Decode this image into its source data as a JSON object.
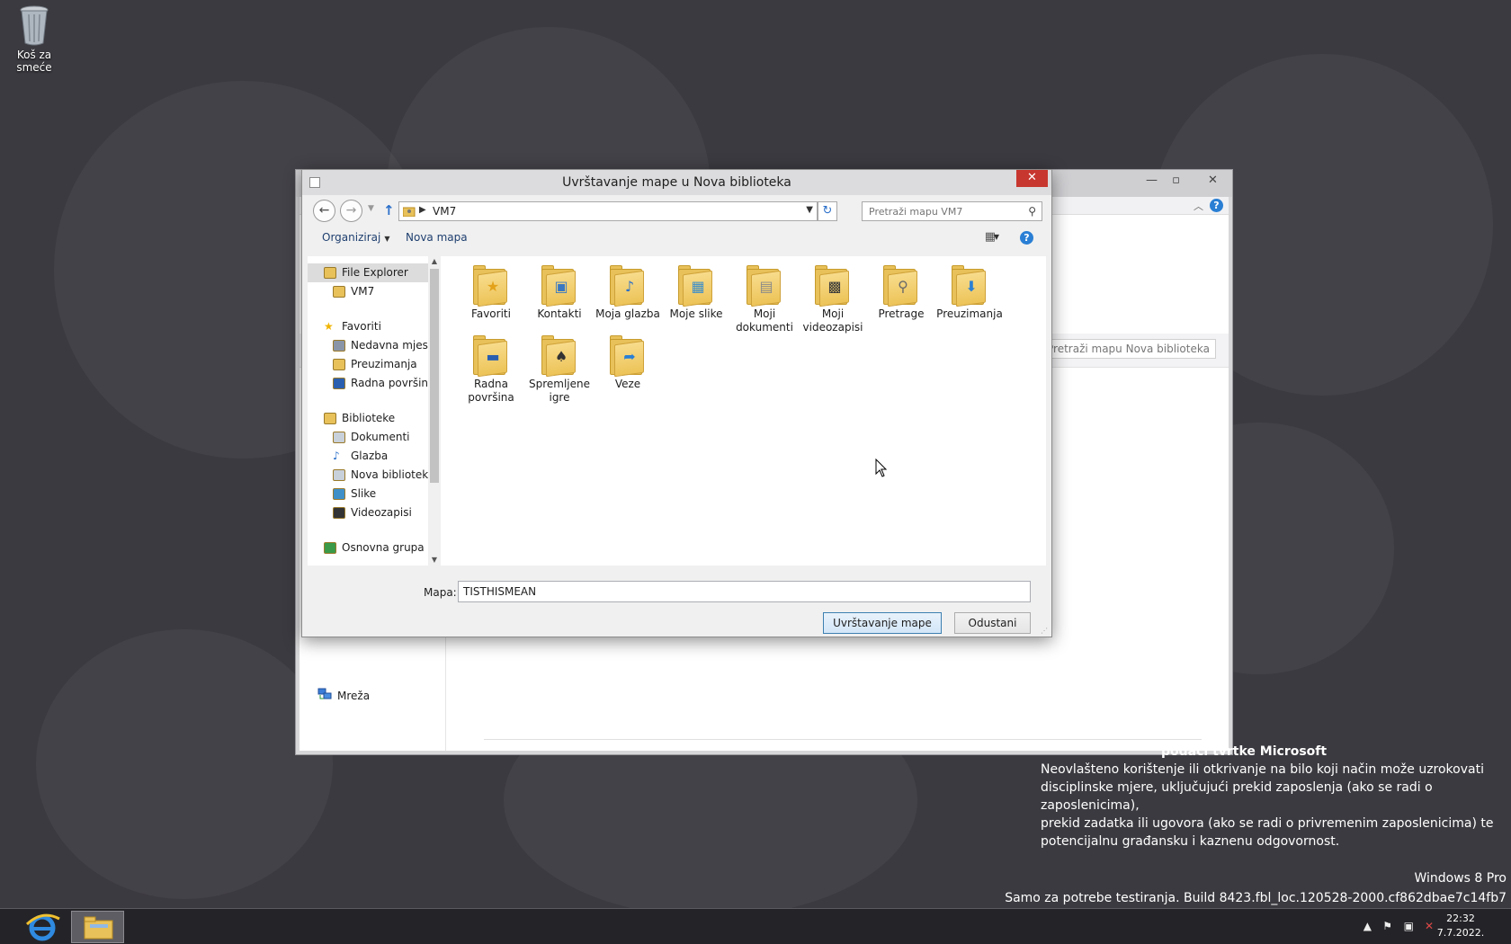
{
  "desktop": {
    "recycle_bin_label": "Koš za smeće"
  },
  "background_window": {
    "search_placeholder": "Pretraži mapu Nova biblioteka",
    "network_label": "Mreža"
  },
  "dialog": {
    "title": "Uvrštavanje mape u Nova biblioteka",
    "address_path": "VM7",
    "search_placeholder": "Pretraži mapu VM7",
    "organize_label": "Organiziraj",
    "new_folder_label": "Nova mapa",
    "nav_tree": [
      {
        "label": "File Explorer",
        "icon": "explorer-icon",
        "indent": 1,
        "selected": true
      },
      {
        "label": "VM7",
        "icon": "user-folder-icon",
        "indent": 2
      },
      {
        "gap": true
      },
      {
        "label": "Favoriti",
        "icon": "star-icon",
        "indent": 1
      },
      {
        "label": "Nedavna mjesta",
        "icon": "recent-places-icon",
        "indent": 2
      },
      {
        "label": "Preuzimanja",
        "icon": "downloads-icon",
        "indent": 2
      },
      {
        "label": "Radna površina",
        "icon": "desktop-icon",
        "indent": 2
      },
      {
        "gap": true
      },
      {
        "label": "Biblioteke",
        "icon": "libraries-icon",
        "indent": 1
      },
      {
        "label": "Dokumenti",
        "icon": "documents-icon",
        "indent": 2
      },
      {
        "label": "Glazba",
        "icon": "music-icon",
        "indent": 2
      },
      {
        "label": "Nova biblioteka",
        "icon": "library-icon",
        "indent": 2
      },
      {
        "label": "Slike",
        "icon": "pictures-icon",
        "indent": 2
      },
      {
        "label": "Videozapisi",
        "icon": "videos-icon",
        "indent": 2
      },
      {
        "gap": true
      },
      {
        "label": "Osnovna grupa",
        "icon": "homegroup-icon",
        "indent": 1
      }
    ],
    "folders": [
      {
        "label": "Favoriti",
        "icon": "favorites-folder-icon",
        "glyph": "★",
        "glyph_color": "#e3a21a"
      },
      {
        "label": "Kontakti",
        "icon": "contacts-folder-icon",
        "glyph": "▣",
        "glyph_color": "#3a78c2"
      },
      {
        "label": "Moja glazba",
        "icon": "music-folder-icon",
        "glyph": "♪",
        "glyph_color": "#2a6fc9"
      },
      {
        "label": "Moje slike",
        "icon": "pictures-folder-icon",
        "glyph": "▦",
        "glyph_color": "#3f8fc9"
      },
      {
        "label": "Moji dokumenti",
        "icon": "documents-folder-icon",
        "glyph": "▤",
        "glyph_color": "#8a8a8a"
      },
      {
        "label": "Moji videozapisi",
        "icon": "videos-folder-icon",
        "glyph": "▩",
        "glyph_color": "#3a3a3a"
      },
      {
        "label": "Pretrage",
        "icon": "searches-folder-icon",
        "glyph": "⚲",
        "glyph_color": "#6a6a6a"
      },
      {
        "label": "Preuzimanja",
        "icon": "downloads-folder-icon",
        "glyph": "⬇",
        "glyph_color": "#2a7fd4"
      },
      {
        "label": "Radna površina",
        "icon": "desktop-folder-icon",
        "glyph": "▬",
        "glyph_color": "#2a5fb0"
      },
      {
        "label": "Spremljene igre",
        "icon": "saved-games-folder-icon",
        "glyph": "♠",
        "glyph_color": "#333333"
      },
      {
        "label": "Veze",
        "icon": "links-folder-icon",
        "glyph": "➦",
        "glyph_color": "#2a7fd4"
      }
    ],
    "folder_field_label": "Mapa:",
    "folder_field_value": "TISTHISMEAN",
    "include_button": "Uvrštavanje mape",
    "cancel_button": "Odustani"
  },
  "watermark": {
    "heading": "podaci tvrtke Microsoft",
    "line1": "Neovlašteno korištenje ili otkrivanje na bilo koji način može uzrokovati",
    "line2": "disciplinske mjere, uključujući prekid zaposlenja (ako se radi o zaposlenicima),",
    "line3": "prekid zadatka ili ugovora (ako se radi o privremenim zaposlenicima) te",
    "line4": "potencijalnu građansku i kaznenu odgovornost."
  },
  "windows": {
    "edition": "Windows 8 Pro",
    "build": "Samo za potrebe testiranja. Build 8423.fbl_loc.120528-2000.cf862dbae7c14fb7"
  },
  "taskbar": {
    "time": "22:32",
    "date": "7.7.2022."
  },
  "colors": {
    "desktop_bg": "#3b3a40",
    "close_red": "#c7372f",
    "accent_blue": "#2a7fd4"
  }
}
